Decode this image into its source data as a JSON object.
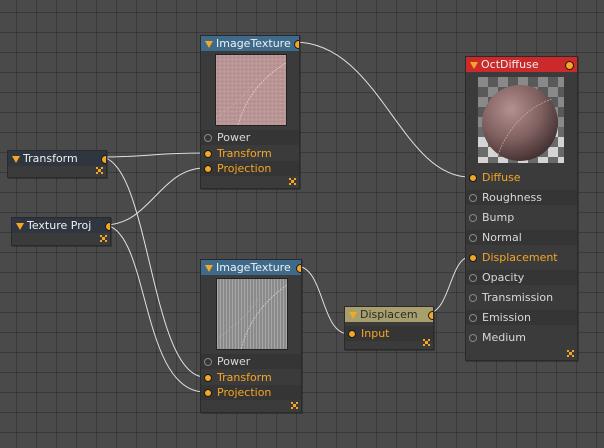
{
  "nodes": {
    "transform": {
      "title": "Transform"
    },
    "texture_proj": {
      "title": "Texture Proj"
    },
    "image_texture_1": {
      "title": "ImageTexture",
      "pins": [
        "Power",
        "Transform",
        "Projection"
      ]
    },
    "image_texture_2": {
      "title": "ImageTexture",
      "pins": [
        "Power",
        "Transform",
        "Projection"
      ]
    },
    "displacement": {
      "title": "Displacem",
      "pins": [
        "Input"
      ]
    },
    "oct_diffuse": {
      "title": "OctDiffuse",
      "pins": [
        "Diffuse",
        "Roughness",
        "Bump",
        "Normal",
        "Displacement",
        "Opacity",
        "Transmission",
        "Emission",
        "Medium"
      ]
    }
  },
  "colors": {
    "background": "#4a4a4a",
    "port_active": "#f5a623",
    "header_texture": "#3e6b8c",
    "header_material": "#cc2a2a",
    "header_displacement": "#a8a06c",
    "wire": "#e0e0e0"
  },
  "icons": [
    "collapse-triangle-icon",
    "resize-handle-icon",
    "port-icon"
  ]
}
